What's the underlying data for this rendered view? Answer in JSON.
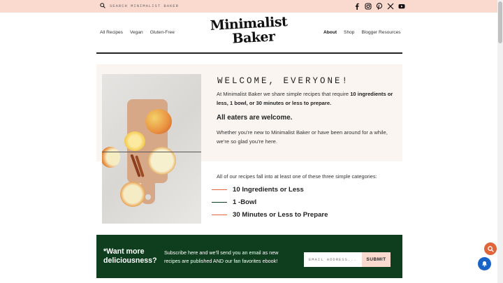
{
  "search": {
    "placeholder": "SEARCH MINIMALIST BAKER"
  },
  "social": [
    "facebook-icon",
    "instagram-icon",
    "pinterest-icon",
    "x-icon",
    "youtube-icon"
  ],
  "nav": {
    "left": [
      "All Recipes",
      "Vegan",
      "Gluten-Free"
    ],
    "right": [
      "About",
      "Shop",
      "Blogger Resources"
    ],
    "active": "About"
  },
  "logo": {
    "line1": "Minimalist",
    "line2": "Baker"
  },
  "welcome": {
    "title": "WELCOME, EVERYONE!",
    "intro_pre": "At Minimalist Baker we share simple recipes that require ",
    "intro_bold": "10 ingredients or less, 1 bowl, or 30 minutes or less to prepare.",
    "eaters": "All eaters are welcome.",
    "whether": "Whether you’re new to Minimalist Baker or have been around for a while, we’re so glad you’re here."
  },
  "categories": {
    "intro": "All of our recipes fall into at least one of these three simple categories:",
    "items": [
      {
        "label": "10 Ingredients or Less",
        "color": "#e0653a"
      },
      {
        "label": "1 -Bowl",
        "color": "#0e3e1e"
      },
      {
        "label": "30 Minutes or Less to Prepare",
        "color": "#e0653a"
      }
    ]
  },
  "newsletter": {
    "title": "*Want more deliciousness?",
    "text": "Subscribe here and we’ll send you an email as new recipes are published AND our fan favorites ebook!",
    "email_placeholder": "EMAIL ADDRESS...",
    "submit": "SUBMIT"
  },
  "colors": {
    "topbar": "#fad9cf",
    "accent": "#e0653a",
    "green": "#0e3e1e",
    "bell": "#1a63c6"
  }
}
